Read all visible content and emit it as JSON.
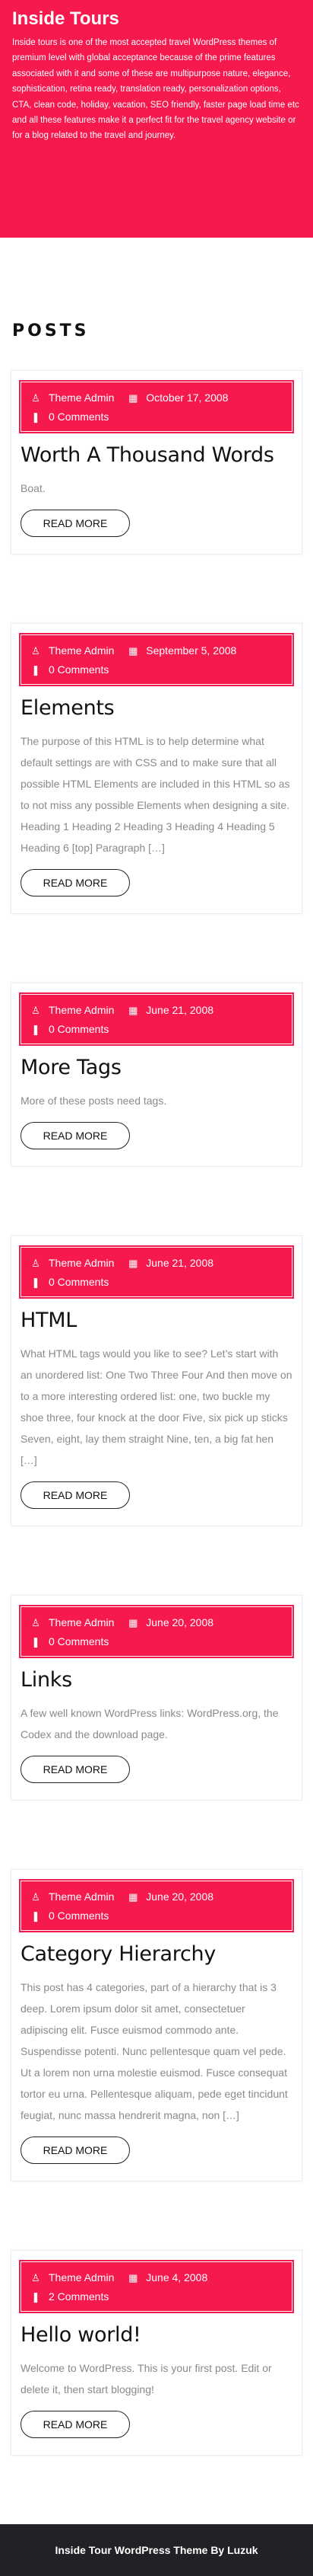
{
  "hero": {
    "title": "Inside Tours",
    "text": "Inside tours is one of the most accepted travel WordPress themes of premium level with global acceptance because of the prime features associated with it and some of these are multipurpose nature, elegance, sophistication, retina ready, translation ready, personalization options, CTA, clean code, holiday, vacation, SEO friendly, faster page load time etc and all these features make it a perfect fit for the travel agency website or for a blog related to the travel and journey."
  },
  "section": {
    "heading": "POSTS"
  },
  "icons": {
    "author": "user-icon",
    "date": "calendar-icon",
    "comments": "comments-icon"
  },
  "colors": {
    "accent": "#f5194e",
    "footer_bg": "#222226"
  },
  "posts": [
    {
      "author": "Theme Admin",
      "date": "October 17, 2008",
      "comments": "0 Comments",
      "title": "Worth A Thousand Words",
      "excerpt": "Boat.",
      "button": "READ MORE"
    },
    {
      "author": "Theme Admin",
      "date": "September 5, 2008",
      "comments": "0 Comments",
      "title": "Elements",
      "excerpt": "The purpose of this HTML is to help determine what default settings are with CSS and to make sure that all possible HTML Elements are included in this HTML so as to not miss any possible Elements when designing a site. Heading 1 Heading 2 Heading 3 Heading 4 Heading 5 Heading 6 [top] Paragraph […]",
      "button": "READ MORE"
    },
    {
      "author": "Theme Admin",
      "date": "June 21, 2008",
      "comments": "0 Comments",
      "title": "More Tags",
      "excerpt": "More of these posts need tags.",
      "button": "READ MORE"
    },
    {
      "author": "Theme Admin",
      "date": "June 21, 2008",
      "comments": "0 Comments",
      "title": "HTML",
      "excerpt": "What HTML tags would you like to see? Let’s start with an unordered list: One Two Three Four And then move on to a more interesting ordered list: one, two buckle my shoe three, four knock at the door Five, six pick up sticks Seven, eight, lay them straight Nine, ten, a big fat hen […]",
      "button": "READ MORE"
    },
    {
      "author": "Theme Admin",
      "date": "June 20, 2008",
      "comments": "0 Comments",
      "title": "Links",
      "excerpt": "A few well known WordPress links: WordPress.org, the Codex and the download page.",
      "button": "READ MORE"
    },
    {
      "author": "Theme Admin",
      "date": "June 20, 2008",
      "comments": "0 Comments",
      "title": "Category Hierarchy",
      "excerpt": "This post has 4 categories, part of a hierarchy that is 3 deep. Lorem ipsum dolor sit amet, consectetuer adipiscing elit. Fusce euismod commodo ante. Suspendisse potenti. Nunc pellentesque quam vel pede. Ut a lorem non urna molestie euismod. Fusce consequat tortor eu urna. Pellentesque aliquam, pede eget tincidunt feugiat, nunc massa hendrerit magna, non […]",
      "button": "READ MORE"
    },
    {
      "author": "Theme Admin",
      "date": "June 4, 2008",
      "comments": "2 Comments",
      "title": "Hello world!",
      "excerpt": "Welcome to WordPress. This is your first post. Edit or delete it, then start blogging!",
      "button": "READ MORE"
    }
  ],
  "footer": {
    "text": "Inside Tour WordPress Theme By Luzuk"
  }
}
